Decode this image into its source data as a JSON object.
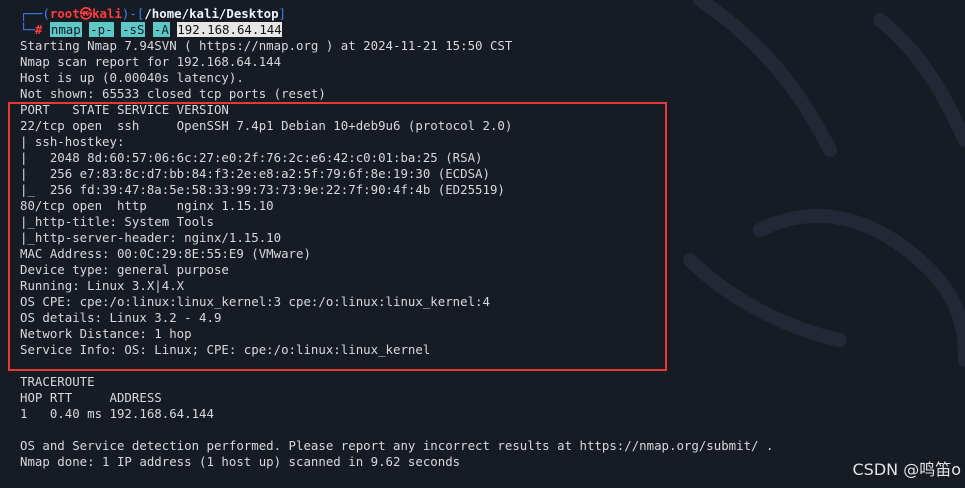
{
  "prompt": {
    "open_bracket": "┌──(",
    "user": "root",
    "skull": "㉿",
    "host": "kali",
    "sep": ")-[",
    "path": "/home/kali/Desktop",
    "close": "]",
    "corner": "└─",
    "hash": "#"
  },
  "command": {
    "program": "nmap",
    "flag1": "-p-",
    "flag2": "-sS",
    "flag3": "-A",
    "target": "192.168.64.144"
  },
  "output": [
    "Starting Nmap 7.94SVN ( https://nmap.org ) at 2024-11-21 15:50 CST",
    "Nmap scan report for 192.168.64.144",
    "Host is up (0.00040s latency).",
    "Not shown: 65533 closed tcp ports (reset)",
    "PORT   STATE SERVICE VERSION",
    "22/tcp open  ssh     OpenSSH 7.4p1 Debian 10+deb9u6 (protocol 2.0)",
    "| ssh-hostkey: ",
    "|   2048 8d:60:57:06:6c:27:e0:2f:76:2c:e6:42:c0:01:ba:25 (RSA)",
    "|   256 e7:83:8c:d7:bb:84:f3:2e:e8:a2:5f:79:6f:8e:19:30 (ECDSA)",
    "|_  256 fd:39:47:8a:5e:58:33:99:73:73:9e:22:7f:90:4f:4b (ED25519)",
    "80/tcp open  http    nginx 1.15.10",
    "|_http-title: System Tools",
    "|_http-server-header: nginx/1.15.10",
    "MAC Address: 00:0C:29:8E:55:E9 (VMware)",
    "Device type: general purpose",
    "Running: Linux 3.X|4.X",
    "OS CPE: cpe:/o:linux:linux_kernel:3 cpe:/o:linux:linux_kernel:4",
    "OS details: Linux 3.2 - 4.9",
    "Network Distance: 1 hop",
    "Service Info: OS: Linux; CPE: cpe:/o:linux:linux_kernel",
    "",
    "TRACEROUTE",
    "HOP RTT     ADDRESS",
    "1   0.40 ms 192.168.64.144",
    "",
    "OS and Service detection performed. Please report any incorrect results at https://nmap.org/submit/ .",
    "Nmap done: 1 IP address (1 host up) scanned in 9.62 seconds"
  ],
  "watermark": "CSDN @鸣笛o",
  "colors": {
    "background": "#171b24",
    "prompt_blue": "#3b82f6",
    "prompt_red": "#ff3b3b",
    "command_highlight": "#5ec8c6",
    "annotation_box": "#e53935"
  }
}
